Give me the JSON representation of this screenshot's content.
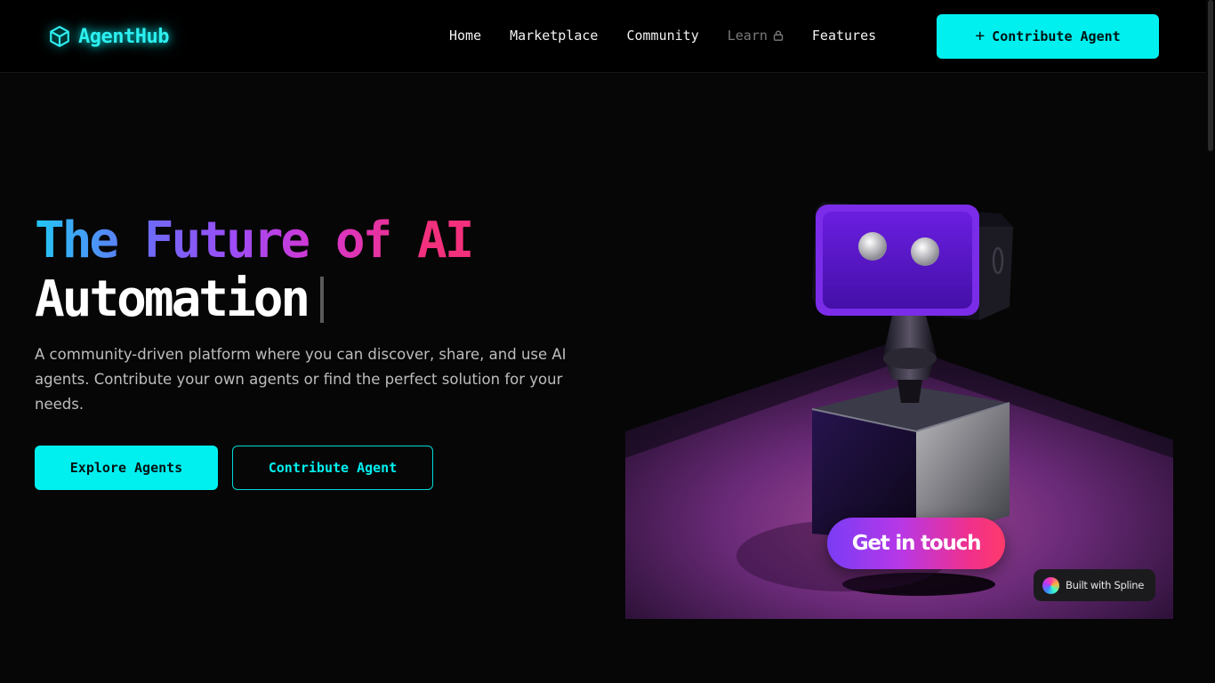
{
  "brand": {
    "name": "AgentHub",
    "icon": "cube-icon",
    "accent": "#00f0f0"
  },
  "nav": {
    "items": [
      {
        "label": "Home",
        "disabled": false
      },
      {
        "label": "Marketplace",
        "disabled": false
      },
      {
        "label": "Community",
        "disabled": false
      },
      {
        "label": "Learn",
        "disabled": true,
        "icon": "lock-icon"
      },
      {
        "label": "Features",
        "disabled": false
      }
    ],
    "cta": {
      "label": "Contribute Agent",
      "icon": "plus-icon"
    }
  },
  "hero": {
    "title_line1": "The Future of AI",
    "title_line2": "Automation",
    "description": "A community-driven platform where you can discover, share, and use AI agents. Contribute your own agents or find the perfect solution for your needs.",
    "primary_button": "Explore Agents",
    "secondary_button": "Contribute Agent"
  },
  "scene": {
    "cta_label": "Get in touch",
    "badge_label": "Built with Spline",
    "colors": {
      "robot_screen": "#5a16c8",
      "floor": "#8a3a8a",
      "cta_gradient_start": "#7a3cf5",
      "cta_gradient_end": "#ff3a6a"
    }
  }
}
